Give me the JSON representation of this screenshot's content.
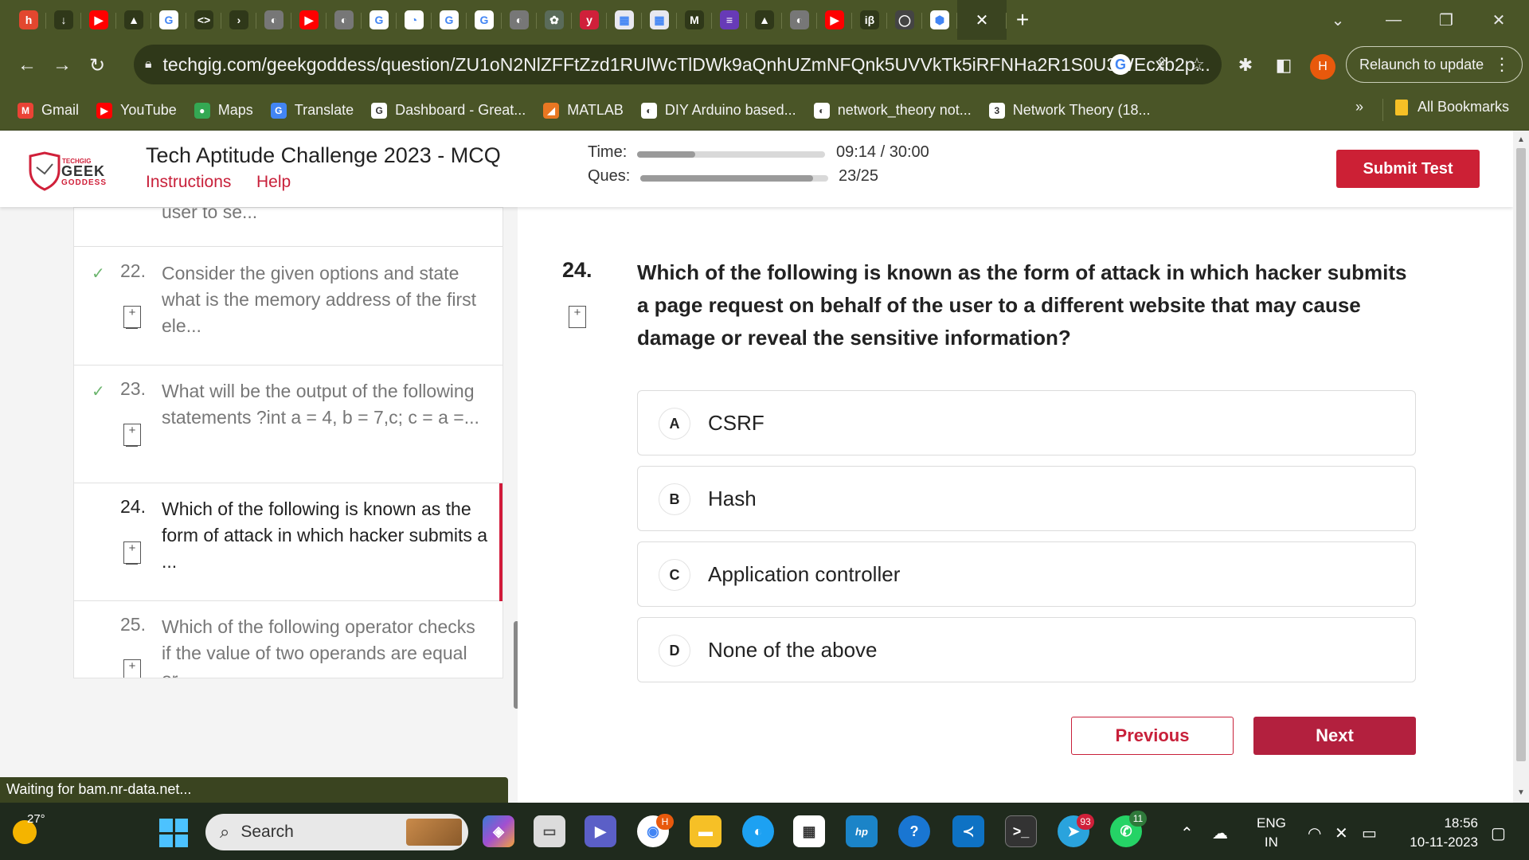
{
  "browser": {
    "tabs": [
      {
        "icon": "hackerrank-icon",
        "color": "#e2472f",
        "glyph": "h"
      },
      {
        "icon": "download-icon",
        "color": "#2f3819",
        "glyph": "↓"
      },
      {
        "icon": "youtube-icon",
        "color": "#ff0000",
        "glyph": "▶"
      },
      {
        "icon": "drive-icon",
        "color": "#2f3819",
        "glyph": "▲"
      },
      {
        "icon": "google-icon",
        "color": "#ffffff",
        "glyph": "G"
      },
      {
        "icon": "code-icon",
        "color": "#2f3819",
        "glyph": "<>"
      },
      {
        "icon": "arrow-icon",
        "color": "#2f3819",
        "glyph": "›"
      },
      {
        "icon": "globe-icon",
        "color": "#777777",
        "glyph": "◐"
      },
      {
        "icon": "youtube-icon",
        "color": "#ff0000",
        "glyph": "▶"
      },
      {
        "icon": "globe-icon",
        "color": "#777777",
        "glyph": "◐"
      },
      {
        "icon": "google-icon",
        "color": "#ffffff",
        "glyph": "G"
      },
      {
        "icon": "github-icon",
        "color": "#ffffff",
        "glyph": "◔"
      },
      {
        "icon": "google-icon",
        "color": "#ffffff",
        "glyph": "G"
      },
      {
        "icon": "google-icon",
        "color": "#ffffff",
        "glyph": "G"
      },
      {
        "icon": "globe-icon",
        "color": "#777777",
        "glyph": "◐"
      },
      {
        "icon": "chatgpt-icon",
        "color": "#5a6b5a",
        "glyph": "✿"
      },
      {
        "icon": "y-icon",
        "color": "#d0203a",
        "glyph": "y"
      },
      {
        "icon": "site-icon",
        "color": "#e8e8f0",
        "glyph": "▦"
      },
      {
        "icon": "site-icon",
        "color": "#e8e8f0",
        "glyph": "▦"
      },
      {
        "icon": "gmail-icon",
        "color": "#2f3819",
        "glyph": "M"
      },
      {
        "icon": "forms-icon",
        "color": "#673ab7",
        "glyph": "≡"
      },
      {
        "icon": "drive-icon",
        "color": "#2f3819",
        "glyph": "▲"
      },
      {
        "icon": "globe-icon",
        "color": "#777777",
        "glyph": "◐"
      },
      {
        "icon": "youtube-icon",
        "color": "#ff0000",
        "glyph": "▶"
      },
      {
        "icon": "ib-icon",
        "color": "#2f3819",
        "glyph": "iβ"
      },
      {
        "icon": "github-icon",
        "color": "#444444",
        "glyph": "◯"
      },
      {
        "icon": "cube-icon",
        "color": "#ffffff",
        "glyph": "⬢"
      }
    ],
    "url": "techgig.com/geekgoddess/question/ZU1oN2NlZFFtZzd1RUlWcTlDWk9aQnhUZmNFQnk5UVVkTk5iRFNHa2R1S0U3WEcxb2p...",
    "profile_initial": "H",
    "relaunch_label": "Relaunch to update",
    "bookmarks": [
      {
        "label": "Gmail",
        "icon": "gmail-icon",
        "color": "#ea4335",
        "glyph": "M"
      },
      {
        "label": "YouTube",
        "icon": "youtube-icon",
        "color": "#ff0000",
        "glyph": "▶"
      },
      {
        "label": "Maps",
        "icon": "maps-icon",
        "color": "#34a853",
        "glyph": "●"
      },
      {
        "label": "Translate",
        "icon": "translate-icon",
        "color": "#4285f4",
        "glyph": "G"
      },
      {
        "label": "Dashboard - Great...",
        "icon": "google-icon",
        "color": "#ffffff",
        "glyph": "G"
      },
      {
        "label": "MATLAB",
        "icon": "matlab-icon",
        "color": "#e87722",
        "glyph": "◢"
      },
      {
        "label": "DIY Arduino based...",
        "icon": "globe-icon",
        "color": "#ffffff",
        "glyph": "◐"
      },
      {
        "label": "network_theory not...",
        "icon": "globe-icon",
        "color": "#ffffff",
        "glyph": "◐"
      },
      {
        "label": "Network Theory (18...",
        "icon": "site-icon",
        "color": "#ffffff",
        "glyph": "3"
      }
    ],
    "more_bookmarks": "»",
    "all_bookmarks": "All Bookmarks"
  },
  "header": {
    "logo_top": "TECHGIG",
    "logo_main": "GEEK",
    "logo_sub": "GODDESS",
    "title": "Tech Aptitude Challenge 2023 - MCQ",
    "instructions": "Instructions",
    "help": "Help",
    "time_label": "Time:",
    "time_value": "09:14 / 30:00",
    "time_progress": 0.31,
    "ques_label": "Ques:",
    "ques_value": "23/25",
    "ques_progress": 0.92,
    "submit": "Submit Test"
  },
  "question_list": {
    "previous_fragment": "user to se...",
    "items": [
      {
        "number": "22.",
        "text": "Consider the given options and state what is the memory address of the first ele...",
        "answered": true,
        "active": false
      },
      {
        "number": "23.",
        "text": "What will be the output of the following statements ?int a = 4, b = 7,c; c = a =...",
        "answered": true,
        "active": false
      },
      {
        "number": "24.",
        "text": "Which of the following is known as the form of attack in which hacker submits a ...",
        "answered": false,
        "active": true
      },
      {
        "number": "25.",
        "text": "Which of the following operator checks if the value of two operands are equal or...",
        "answered": false,
        "active": false
      }
    ]
  },
  "question": {
    "number": "24.",
    "text": "Which of the following is known as the form of attack in which hacker submits a page request on behalf of the user to a different website that may cause damage or reveal the sensitive information?",
    "options": [
      {
        "letter": "A",
        "text": "CSRF"
      },
      {
        "letter": "B",
        "text": "Hash"
      },
      {
        "letter": "C",
        "text": "Application controller"
      },
      {
        "letter": "D",
        "text": "None of the above"
      }
    ],
    "previous": "Previous",
    "next": "Next"
  },
  "status_text": "Waiting for bam.nr-data.net...",
  "taskbar": {
    "temperature": "27°",
    "search_placeholder": "Search",
    "chrome_badge": "H",
    "telegram_badge": "93",
    "whatsapp_badge": "11",
    "lang_top": "ENG",
    "lang_bottom": "IN",
    "time": "18:56",
    "date": "10-11-2023"
  }
}
